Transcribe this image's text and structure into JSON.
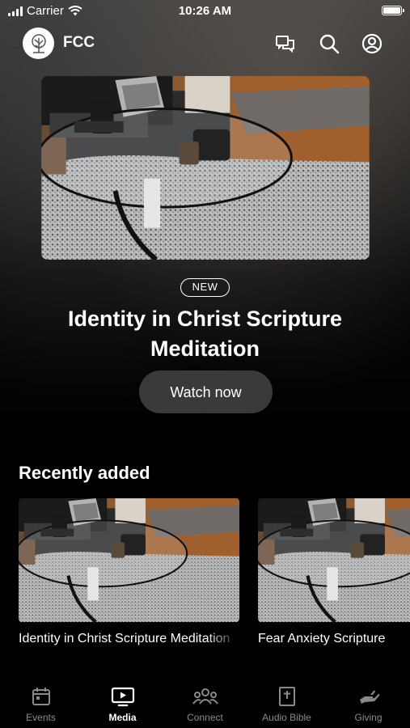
{
  "status_bar": {
    "carrier": "Carrier",
    "time": "10:26 AM",
    "icons": [
      "signal-icon",
      "wifi-icon",
      "battery-icon"
    ]
  },
  "header": {
    "brand": "FCC",
    "icons": [
      "chat-icon",
      "search-icon",
      "profile-icon"
    ]
  },
  "hero": {
    "badge": "NEW",
    "title": "Identity in Christ Scripture Meditation",
    "cta_label": "Watch now"
  },
  "recent": {
    "heading": "Recently added",
    "items": [
      {
        "title": "Identity in Christ Scripture Meditation"
      },
      {
        "title": "Fear Anxiety Scripture"
      }
    ]
  },
  "tabs": [
    {
      "label": "Events",
      "icon": "calendar-icon",
      "active": false
    },
    {
      "label": "Media",
      "icon": "media-icon",
      "active": true
    },
    {
      "label": "Connect",
      "icon": "people-icon",
      "active": false
    },
    {
      "label": "Audio Bible",
      "icon": "bible-icon",
      "active": false
    },
    {
      "label": "Giving",
      "icon": "giving-hand-icon",
      "active": false
    }
  ],
  "colors": {
    "background": "#000000",
    "button_bg": "#3a3a3a",
    "inactive_tab": "#8a8a8a",
    "active_tab": "#ffffff"
  }
}
